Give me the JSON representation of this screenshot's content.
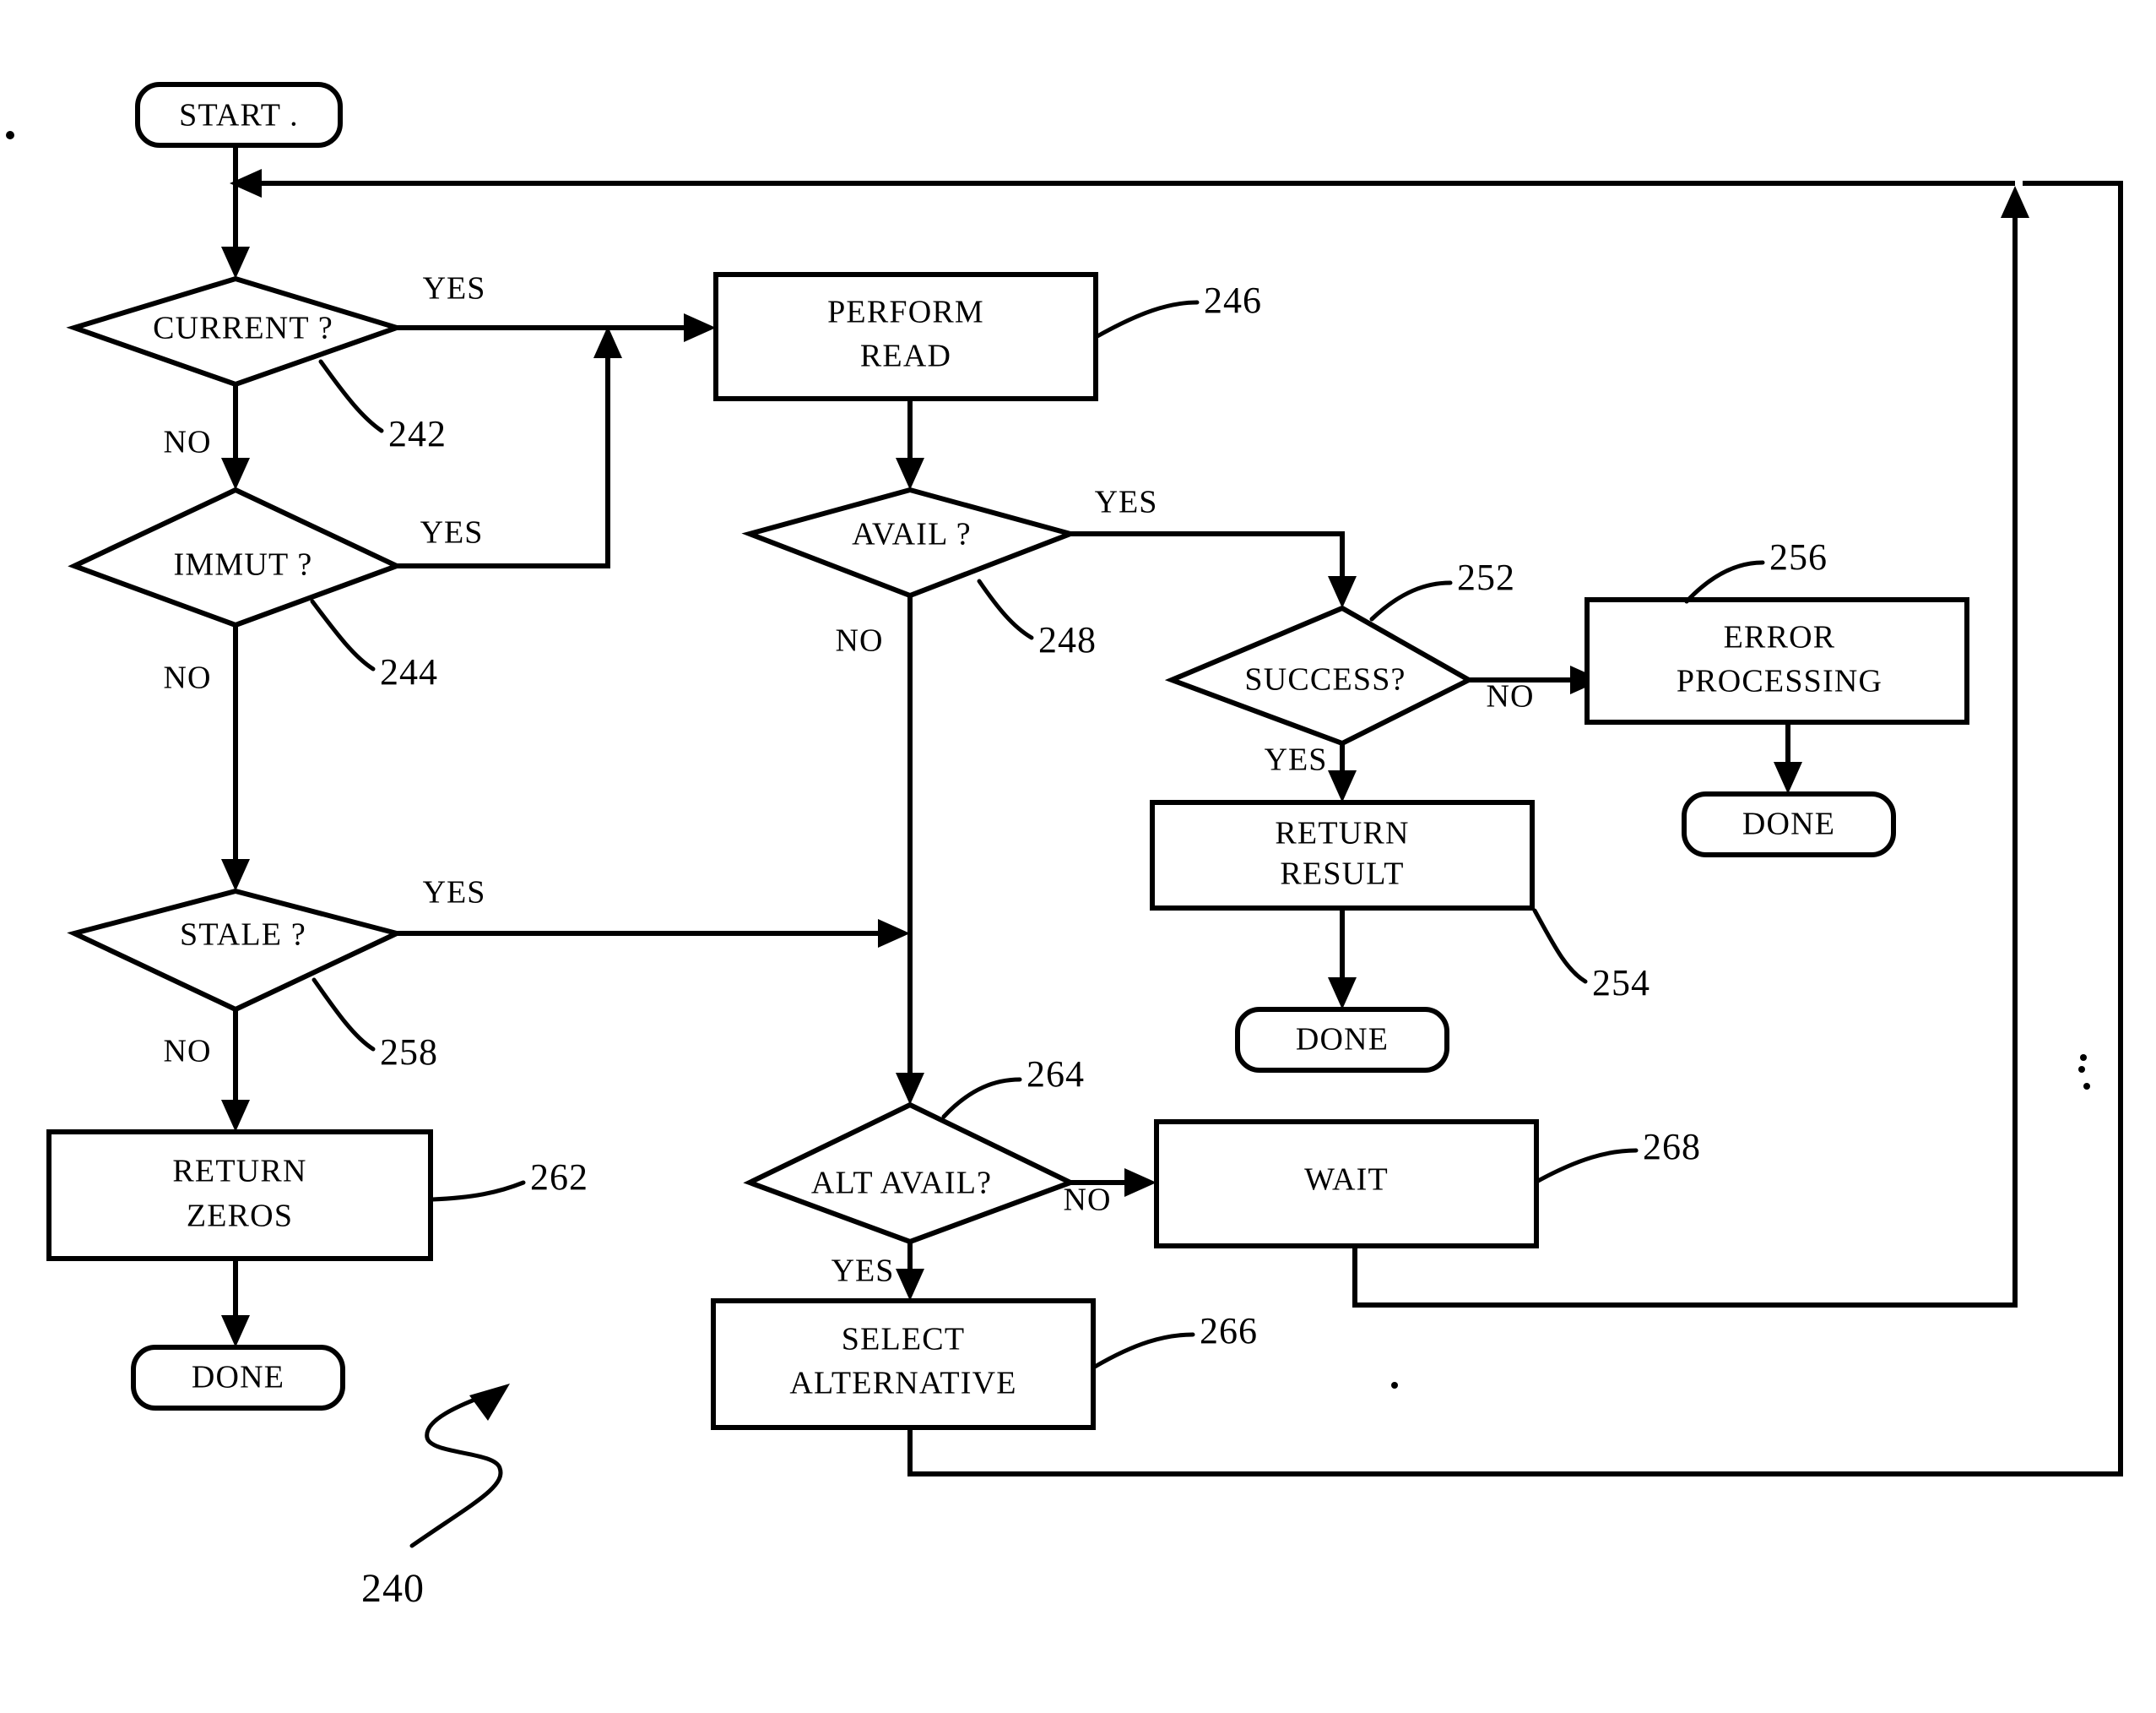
{
  "diagram": {
    "kind": "flowchart",
    "figure_reference": "240",
    "nodes": [
      {
        "id": "start",
        "label": "START .",
        "shape": "terminator",
        "ref": ""
      },
      {
        "id": "current",
        "label": "CURRENT ?",
        "shape": "decision",
        "ref": "242"
      },
      {
        "id": "immut",
        "label": "IMMUT ?",
        "shape": "decision",
        "ref": "244"
      },
      {
        "id": "stale",
        "label": "STALE ?",
        "shape": "decision",
        "ref": "258"
      },
      {
        "id": "ret_zeros",
        "label": "RETURN ZEROS",
        "shape": "process",
        "ref": "262"
      },
      {
        "id": "done_zeros",
        "label": "DONE",
        "shape": "terminator",
        "ref": ""
      },
      {
        "id": "perf_read",
        "label": "PERFORM READ",
        "shape": "process",
        "ref": "246"
      },
      {
        "id": "avail",
        "label": "AVAIL ?",
        "shape": "decision",
        "ref": "248"
      },
      {
        "id": "success",
        "label": "SUCCESS?",
        "shape": "decision",
        "ref": "252"
      },
      {
        "id": "err_proc",
        "label": "ERROR PROCESSING",
        "shape": "process",
        "ref": "256"
      },
      {
        "id": "done_err",
        "label": "DONE",
        "shape": "terminator",
        "ref": ""
      },
      {
        "id": "ret_result",
        "label": "RETURN RESULT",
        "shape": "process",
        "ref": "254"
      },
      {
        "id": "done_res",
        "label": "DONE",
        "shape": "terminator",
        "ref": ""
      },
      {
        "id": "alt_avail",
        "label": "ALT AVAIL?",
        "shape": "decision",
        "ref": "264"
      },
      {
        "id": "wait",
        "label": "WAIT",
        "shape": "process",
        "ref": "268"
      },
      {
        "id": "sel_alt",
        "label": "SELECT ALTERNATIVE",
        "shape": "process",
        "ref": "266"
      }
    ],
    "node_text": {
      "start": "START .",
      "current": "CURRENT ?",
      "immut": "IMMUT ?",
      "stale": "STALE ?",
      "ret_zeros_l1": "RETURN",
      "ret_zeros_l2": "ZEROS",
      "done_zeros": "DONE",
      "perf_read_l1": "PERFORM",
      "perf_read_l2": "READ",
      "avail": "AVAIL ?",
      "success": "SUCCESS?",
      "err_proc_l1": "ERROR",
      "err_proc_l2": "PROCESSING",
      "done_err": "DONE",
      "ret_result_l1": "RETURN",
      "ret_result_l2": "RESULT",
      "done_res": "DONE",
      "alt_avail": "ALT AVAIL?",
      "wait": "WAIT",
      "sel_alt_l1": "SELECT",
      "sel_alt_l2": "ALTERNATIVE"
    },
    "ref_numbers": {
      "fig": "240",
      "current": "242",
      "immut": "244",
      "perf_read": "246",
      "avail": "248",
      "success": "252",
      "ret_result": "254",
      "err_proc": "256",
      "stale": "258",
      "ret_zeros": "262",
      "alt_avail": "264",
      "sel_alt": "266",
      "wait": "268"
    },
    "edge_labels": {
      "current_yes": "YES",
      "current_no": "NO",
      "immut_yes": "YES",
      "immut_no": "NO",
      "stale_yes": "YES",
      "stale_no": "NO",
      "avail_yes": "YES",
      "avail_no": "NO",
      "success_yes": "YES",
      "success_no": "NO",
      "alt_yes": "YES",
      "alt_no": "NO"
    },
    "colors": {
      "stroke": "#000000",
      "fill": "#ffffff",
      "background": "#ffffff"
    }
  }
}
